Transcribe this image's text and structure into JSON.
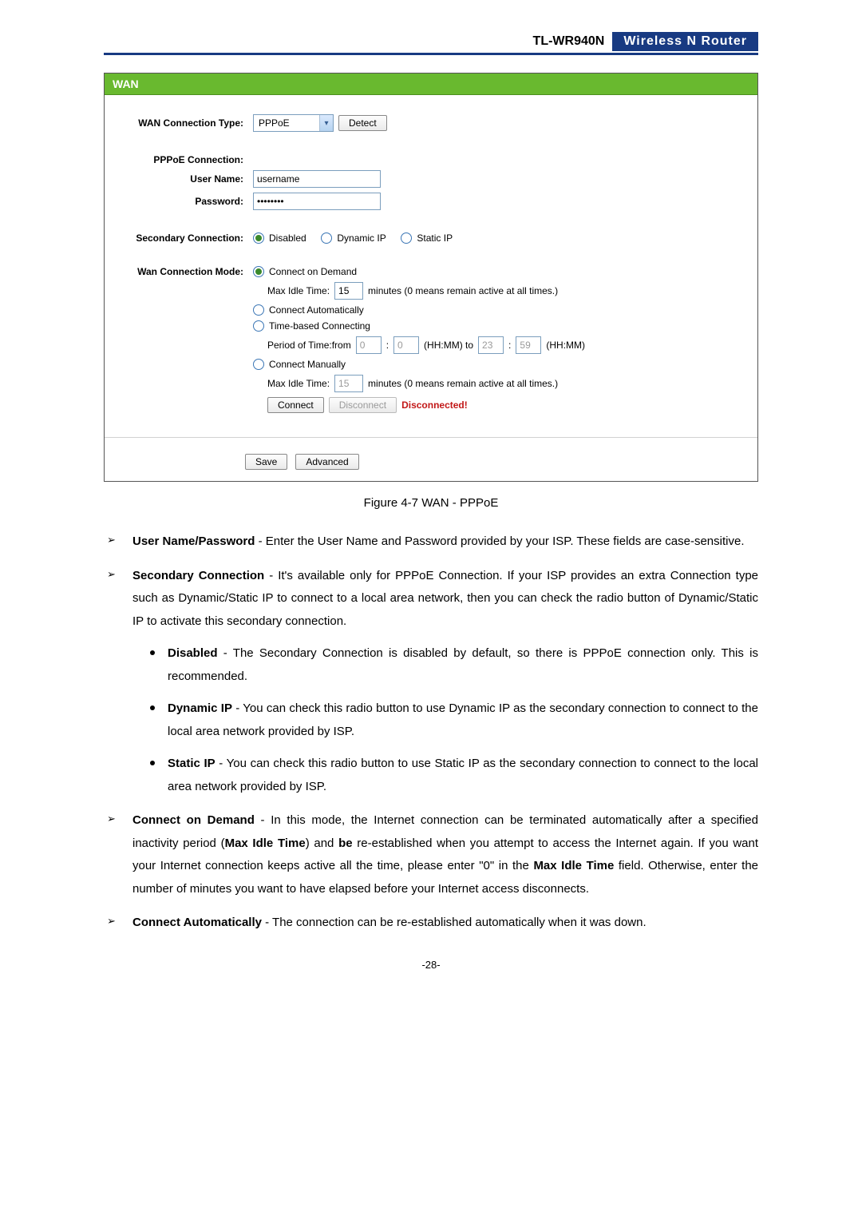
{
  "header": {
    "model": "TL-WR940N",
    "product": "Wireless  N  Router"
  },
  "shot": {
    "title": "WAN",
    "rows": {
      "conn_type_lbl": "WAN Connection Type:",
      "conn_type_val": "PPPoE",
      "detect_btn": "Detect",
      "pppoe_section": "PPPoE Connection:",
      "user_lbl": "User Name:",
      "user_val": "username",
      "pass_lbl": "Password:",
      "pass_val": "••••••••",
      "sec_lbl": "Secondary Connection:",
      "sec_opts": {
        "disabled": "Disabled",
        "dynamic": "Dynamic IP",
        "static": "Static IP"
      },
      "mode_lbl": "Wan Connection Mode:",
      "mode_opts": {
        "demand": "Connect on Demand",
        "auto": "Connect Automatically",
        "time": "Time-based Connecting",
        "manual": "Connect Manually"
      },
      "idle_lbl": "Max Idle Time:",
      "idle1_val": "15",
      "idle2_val": "15",
      "idle_tail": "minutes (0 means remain active at all times.)",
      "period_lbl": "Period of Time:from",
      "period_from_h": "0",
      "period_from_m": "0",
      "period_mid": "(HH:MM) to",
      "period_to_h": "23",
      "period_to_m": "59",
      "period_tail": "(HH:MM)",
      "connect_btn": "Connect",
      "disconnect_btn": "Disconnect",
      "status": "Disconnected!",
      "save_btn": "Save",
      "adv_btn": "Advanced"
    }
  },
  "figure_caption": "Figure 4-7    WAN - PPPoE",
  "body": {
    "t1": "User Name/Password",
    "p1": " - Enter the User Name and Password provided by your ISP. These fields are case-sensitive.",
    "t2": "Secondary Connection",
    "p2": " - It's available only for PPPoE Connection. If your ISP provides an extra Connection type such as Dynamic/Static IP to connect to a local area network, then you can check the radio button of Dynamic/Static IP to activate this secondary connection.",
    "s1t": "Disabled",
    "s1p": " - The Secondary Connection is disabled by default, so there is PPPoE connection only. This is recommended.",
    "s2t": "Dynamic IP",
    "s2p": " - You can check this radio button to use Dynamic IP as the secondary connection to connect to the local area network provided by ISP.",
    "s3t": "Static IP",
    "s3p": " - You can check this radio button to use Static IP as the secondary connection to connect to the local area network provided by ISP.",
    "t3": "Connect on Demand",
    "p3a": " - In this mode, the Internet connection can be terminated automatically after a specified inactivity period (",
    "p3b": "Max Idle Time",
    "p3c": ") and ",
    "p3d": "be",
    "p3e": " re-established when you attempt to access the Internet again. If you want your Internet connection keeps active all the time, please enter \"0\" in the ",
    "p3f": "Max Idle Time",
    "p3g": " field. Otherwise, enter the number of minutes you want to have elapsed before your Internet access disconnects.",
    "t4": "Connect Automatically",
    "p4": " - The connection can be re-established automatically when it was down."
  },
  "page_num": "-28-"
}
